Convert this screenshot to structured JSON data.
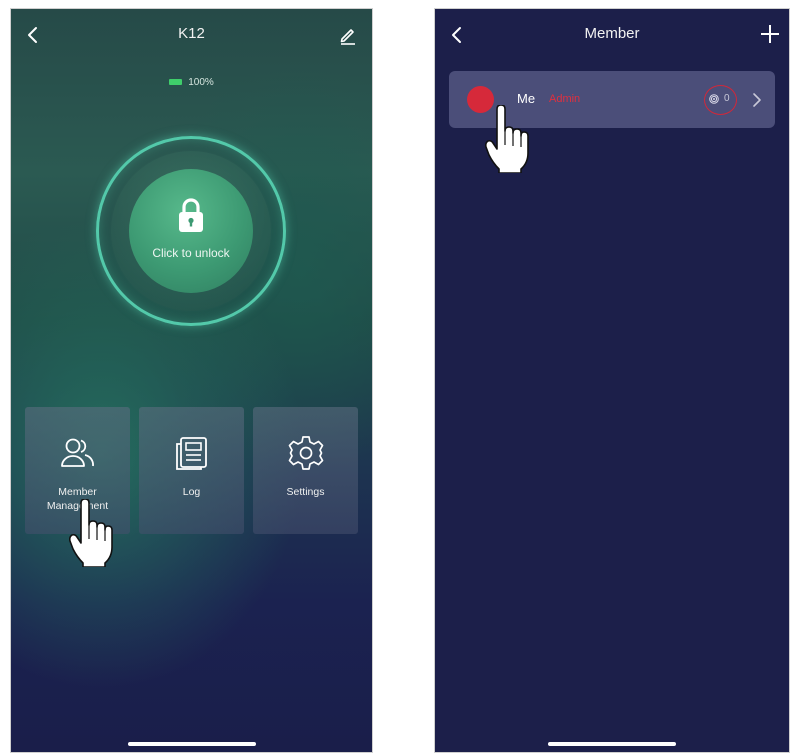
{
  "left_screen": {
    "title": "K12",
    "battery": "100%",
    "unlock_label": "Click to unlock",
    "tiles": [
      {
        "label": "Member Management",
        "icon": "members-icon"
      },
      {
        "label": "Log",
        "icon": "log-icon"
      },
      {
        "label": "Settings",
        "icon": "settings-gear-icon"
      }
    ]
  },
  "right_screen": {
    "title": "Member",
    "member": {
      "name": "Me",
      "role": "Admin",
      "fingerprint_count": "0"
    }
  },
  "colors": {
    "accent_green": "#53c9aa",
    "battery_green": "#3fce6b",
    "navy_background": "#1c1f4a",
    "highlight_red": "#d0283a"
  }
}
